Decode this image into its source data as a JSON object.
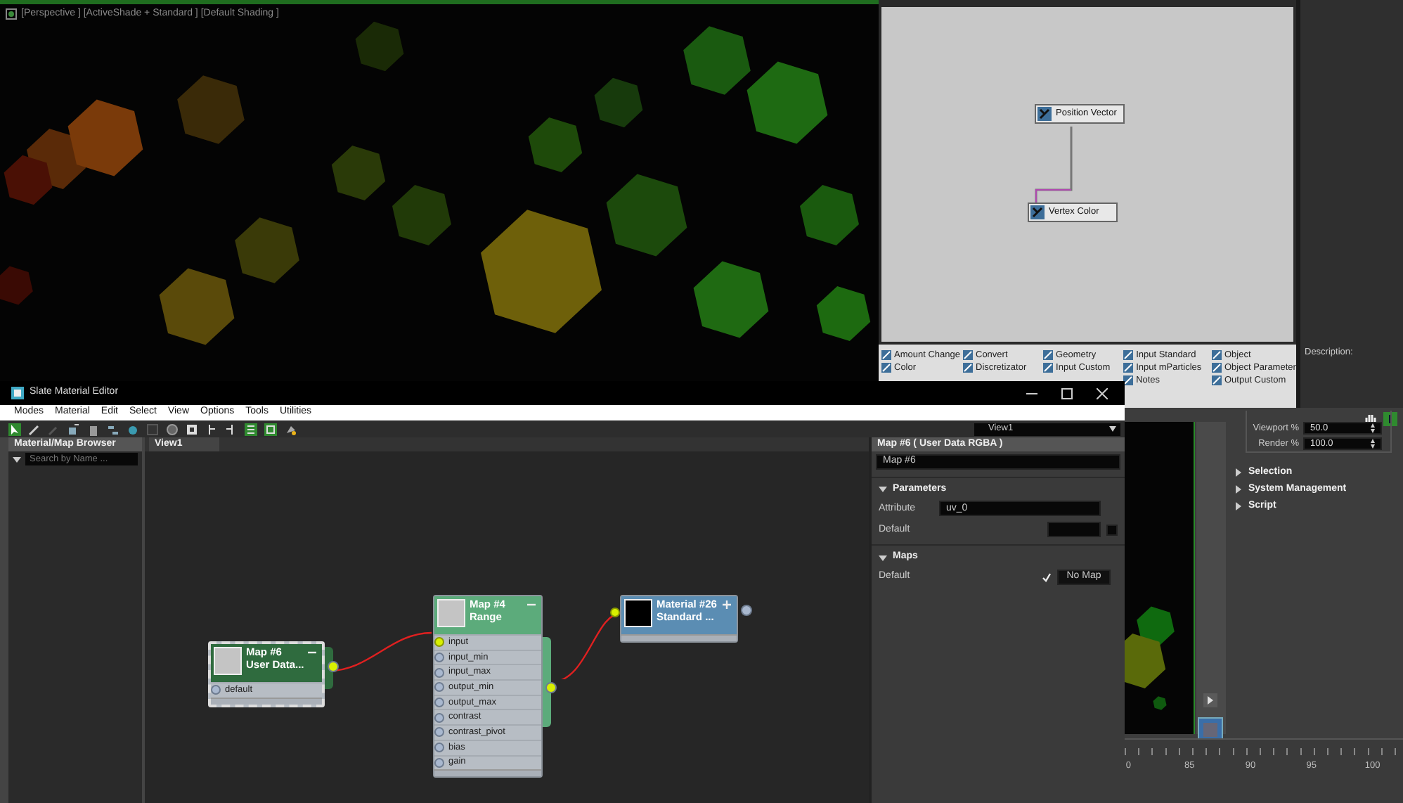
{
  "viewport": {
    "label": "[Perspective ] [ActiveShade + Standard ] [Default Shading ]"
  },
  "particle_view": {
    "nodes": [
      {
        "label": "Position Vector"
      },
      {
        "label": "Vertex Color"
      }
    ],
    "depot": [
      {
        "items": [
          "Amount Change",
          "Color"
        ]
      },
      {
        "items": [
          "Convert",
          "Discretizator"
        ]
      },
      {
        "items": [
          "Geometry",
          "Input Custom"
        ]
      },
      {
        "items": [
          "Input Standard",
          "Input mParticles",
          "Notes"
        ]
      },
      {
        "items": [
          "Object",
          "Object Parameter",
          "Output Custom"
        ]
      }
    ],
    "description_label": "Description:"
  },
  "slate": {
    "title": "Slate Material Editor",
    "menu": [
      "Modes",
      "Material",
      "Edit",
      "Select",
      "View",
      "Options",
      "Tools",
      "Utilities"
    ],
    "view_dropdown": "View1",
    "browser": {
      "title": "Material/Map Browser",
      "search_placeholder": "Search by Name ..."
    },
    "view_tab": "View1",
    "nodes": [
      {
        "title": "Map #6",
        "subtitle": "User Data...",
        "kind": "user",
        "selected": true,
        "expanded": true,
        "output_connected": true,
        "ports": [
          {
            "label": "default",
            "connected": false
          }
        ]
      },
      {
        "title": "Map #4",
        "subtitle": "Range",
        "kind": "map",
        "selected": false,
        "expanded": true,
        "output_connected": true,
        "ports": [
          {
            "label": "input",
            "connected": true
          },
          {
            "label": "input_min",
            "connected": false
          },
          {
            "label": "input_max",
            "connected": false
          },
          {
            "label": "output_min",
            "connected": false
          },
          {
            "label": "output_max",
            "connected": false
          },
          {
            "label": "contrast",
            "connected": false
          },
          {
            "label": "contrast_pivot",
            "connected": false
          },
          {
            "label": "bias",
            "connected": false
          },
          {
            "label": "gain",
            "connected": false
          }
        ]
      },
      {
        "title": "Material #26",
        "subtitle": "Standard ...",
        "kind": "material",
        "selected": false,
        "expanded": false,
        "output_connected": false,
        "input_connected": true
      }
    ],
    "params": {
      "header": "Map #6  ( User Data RGBA )",
      "name": "Map #6",
      "rollouts": [
        {
          "title": "Parameters",
          "expanded": true,
          "rows": [
            {
              "kind": "text",
              "label": "Attribute",
              "value": "uv_0"
            },
            {
              "kind": "color",
              "label": "Default"
            }
          ]
        },
        {
          "title": "Maps",
          "expanded": true,
          "rows": [
            {
              "kind": "map",
              "label": "Default",
              "checked": true,
              "button": "No Map"
            }
          ]
        }
      ]
    }
  },
  "right_panel": {
    "spinners": [
      {
        "label": "Viewport %",
        "value": "50.0"
      },
      {
        "label": "Render %",
        "value": "100.0"
      }
    ],
    "rollouts": [
      {
        "title": "Selection",
        "expanded": false
      },
      {
        "title": "System Management",
        "expanded": false
      },
      {
        "title": "Script",
        "expanded": false
      }
    ]
  },
  "timeline": {
    "ticks": [
      "0",
      "85",
      "90",
      "95",
      "100"
    ]
  }
}
